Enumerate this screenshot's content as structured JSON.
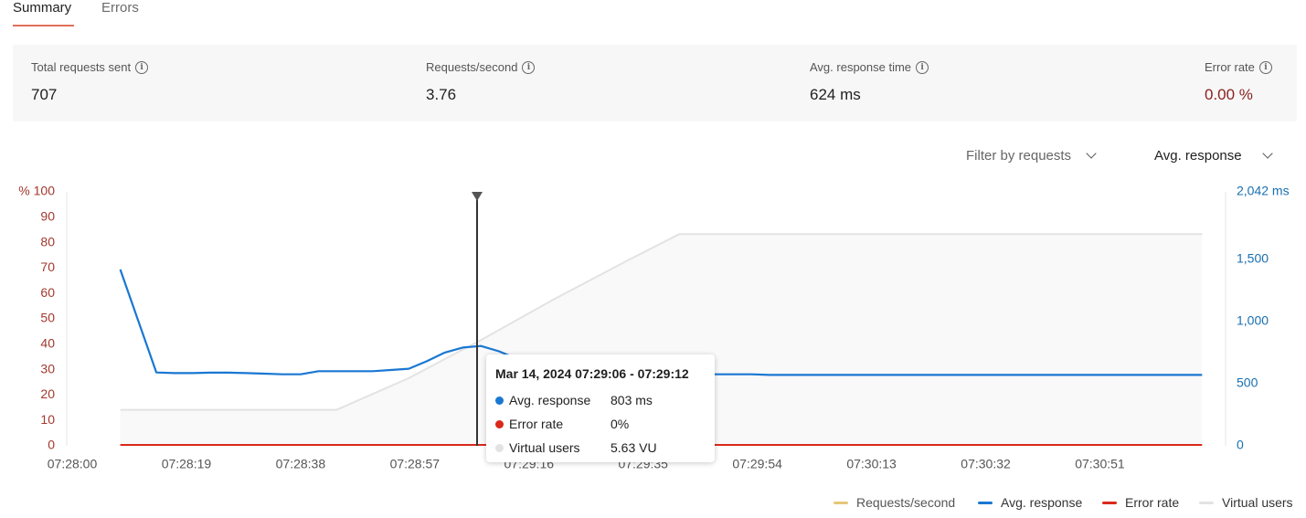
{
  "tabs": [
    {
      "label": "Summary",
      "active": true
    },
    {
      "label": "Errors",
      "active": false
    }
  ],
  "stats": [
    {
      "label": "Total requests sent",
      "value": "707"
    },
    {
      "label": "Requests/second",
      "value": "3.76"
    },
    {
      "label": "Avg. response time",
      "value": "624 ms"
    },
    {
      "label": "Error rate",
      "value": "0.00 %"
    }
  ],
  "filters": {
    "requests_label": "Filter by requests",
    "metric_label": "Avg. response"
  },
  "colors": {
    "accent_tab": "#e2705a",
    "left_axis": "#a3382e",
    "right_axis": "#1a6fb0",
    "avg_response": "#1a77d2",
    "error_rate": "#d9291c",
    "virtual_users": "#e3e3e3",
    "requests_per_second": "#e5c77a",
    "error_value": "#8b1e1e"
  },
  "chart_data": {
    "type": "line",
    "x_ticks": [
      "07:28:00",
      "07:28:19",
      "07:28:38",
      "07:28:57",
      "07:29:16",
      "07:29:35",
      "07:29:54",
      "07:30:13",
      "07:30:32",
      "07:30:51"
    ],
    "left_axis": {
      "unit": "%",
      "ticks": [
        "% 100",
        "90",
        "80",
        "70",
        "60",
        "50",
        "40",
        "30",
        "20",
        "10",
        "0"
      ],
      "range": [
        0,
        100
      ]
    },
    "right_axis": {
      "unit": "ms",
      "ticks": [
        "2,042 ms",
        "1,500",
        "1,000",
        "500",
        "0"
      ],
      "range": [
        0,
        2042
      ]
    },
    "x_seconds": [
      0,
      19,
      38,
      57,
      76,
      95,
      114,
      133,
      152,
      171
    ],
    "series": [
      {
        "name": "Avg. response",
        "axis": "right",
        "x": [
          8,
          14,
          17,
          20,
          23,
          26,
          29,
          32,
          35,
          38,
          41,
          44,
          47,
          50,
          53,
          56,
          59,
          62,
          65,
          68,
          71,
          74,
          77,
          80,
          83,
          86,
          89,
          92,
          95,
          98,
          101,
          104,
          107,
          110,
          113,
          116,
          119,
          122,
          125,
          128,
          131,
          134,
          137,
          140,
          143,
          146,
          149,
          152,
          155,
          158,
          161,
          164,
          167,
          170,
          173,
          176,
          179,
          182,
          185,
          188
        ],
        "y": [
          1418,
          590,
          585,
          585,
          588,
          588,
          585,
          580,
          575,
          575,
          600,
          600,
          600,
          600,
          610,
          620,
          680,
          750,
          790,
          803,
          760,
          700,
          650,
          610,
          590,
          580,
          580,
          580,
          580,
          580,
          575,
          575,
          575,
          575,
          575,
          570,
          570,
          570,
          570,
          570,
          570,
          570,
          570,
          570,
          570,
          570,
          570,
          570,
          570,
          570,
          570,
          570,
          570,
          570,
          570,
          570,
          570,
          570,
          570,
          570
        ]
      },
      {
        "name": "Error rate",
        "axis": "left",
        "x": [
          8,
          188
        ],
        "y": [
          0,
          0
        ]
      },
      {
        "name": "Virtual users",
        "axis": "vu",
        "x": [
          8,
          44,
          56,
          68,
          80,
          92,
          101,
          188
        ],
        "y": [
          1.7,
          1.7,
          3.2,
          5.0,
          6.9,
          8.7,
          10.0,
          10.0
        ]
      }
    ],
    "legend": [
      "Requests/second",
      "Avg. response",
      "Error rate",
      "Virtual users"
    ],
    "legend_placement": "bottom-right",
    "grid": false,
    "cursor_label_time": "07:29:09"
  },
  "tooltip": {
    "title": "Mar 14, 2024 07:29:06 - 07:29:12",
    "rows": [
      {
        "label": "Avg. response",
        "value": "803 ms"
      },
      {
        "label": "Error rate",
        "value": "0%"
      },
      {
        "label": "Virtual users",
        "value": "5.63 VU"
      }
    ]
  }
}
